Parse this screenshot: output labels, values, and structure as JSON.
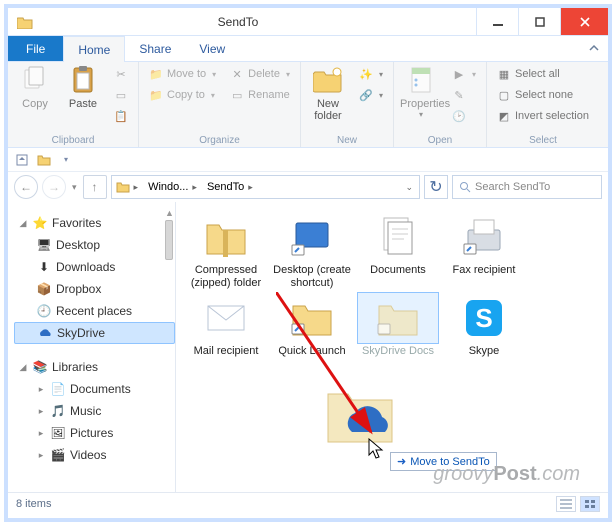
{
  "window": {
    "title": "SendTo"
  },
  "tabs": {
    "file": "File",
    "home": "Home",
    "share": "Share",
    "view": "View"
  },
  "ribbon": {
    "clipboard": {
      "label": "Clipboard",
      "copy": "Copy",
      "paste": "Paste"
    },
    "organize": {
      "label": "Organize",
      "moveTo": "Move to",
      "copyTo": "Copy to",
      "delete": "Delete",
      "rename": "Rename"
    },
    "new": {
      "label": "New",
      "newFolder": "New\nfolder"
    },
    "open": {
      "label": "Open",
      "properties": "Properties"
    },
    "select": {
      "label": "Select",
      "selectAll": "Select all",
      "selectNone": "Select none",
      "invert": "Invert selection"
    }
  },
  "address": {
    "crumbs": [
      "Windo...",
      "SendTo"
    ],
    "searchPlaceholder": "Search SendTo"
  },
  "tree": {
    "favorites": "Favorites",
    "desktop": "Desktop",
    "downloads": "Downloads",
    "dropbox": "Dropbox",
    "recent": "Recent places",
    "skydrive": "SkyDrive",
    "libraries": "Libraries",
    "documents": "Documents",
    "music": "Music",
    "pictures": "Pictures",
    "videos": "Videos"
  },
  "items": [
    {
      "name": "Compressed (zipped) folder"
    },
    {
      "name": "Desktop (create shortcut)"
    },
    {
      "name": "Documents"
    },
    {
      "name": "Fax recipient"
    },
    {
      "name": "Mail recipient"
    },
    {
      "name": "Quick Launch"
    },
    {
      "name": "SkyDrive Docs"
    },
    {
      "name": "Skype"
    }
  ],
  "drag": {
    "tooltip": "Move to SendTo"
  },
  "status": {
    "count": "8 items"
  },
  "watermark": {
    "a": "groovy",
    "b": "Post"
  }
}
